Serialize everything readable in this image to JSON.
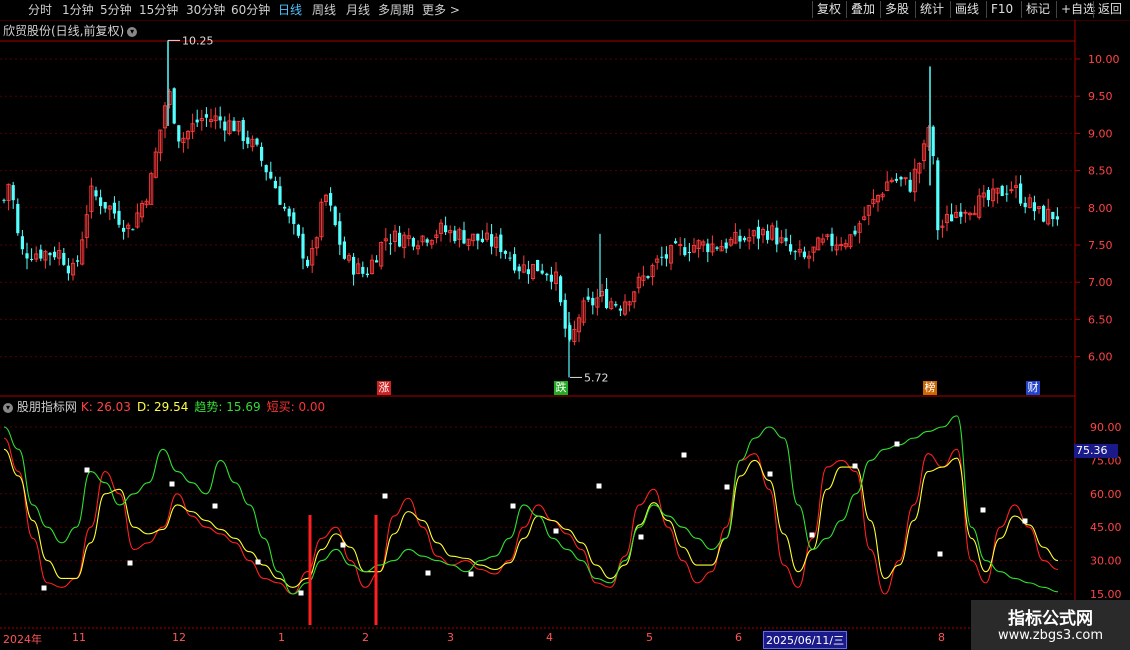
{
  "toolbar": {
    "periods": [
      "分时",
      "1分钟",
      "5分钟",
      "15分钟",
      "30分钟",
      "60分钟",
      "日线",
      "周线",
      "月线",
      "多周期",
      "更多 >"
    ],
    "active_period": "日线",
    "right_buttons": [
      "复权",
      "叠加",
      "多股",
      "统计",
      "画线",
      "F10",
      "标记",
      "+自选",
      "返回"
    ]
  },
  "stock": {
    "title": "欣贸股份(日线,前复权)"
  },
  "price_axis": [
    "10.00",
    "9.50",
    "9.00",
    "8.50",
    "8.00",
    "7.50",
    "7.00",
    "6.50",
    "6.00"
  ],
  "price_markers": {
    "high": "10.25",
    "low": "5.72"
  },
  "flags": [
    {
      "label": "涨",
      "color": "#cc2222"
    },
    {
      "label": "跌",
      "color": "#22aa22"
    },
    {
      "label": "榜",
      "color": "#cc6600"
    },
    {
      "label": "财",
      "color": "#2244cc"
    }
  ],
  "indicator": {
    "name": "股朋指标网",
    "k": "K: 26.03",
    "d": "D: 29.54",
    "trend": "趋势: 15.69",
    "buy": "短买: 0.00",
    "axis": [
      "90.00",
      "75.00",
      "60.00",
      "45.00",
      "30.00",
      "15.00"
    ],
    "current_value": "75.36"
  },
  "x_axis": [
    "2024年",
    "11",
    "12",
    "1",
    "2",
    "3",
    "4",
    "5",
    "6",
    "2025/06/11/三",
    "8"
  ],
  "watermark": {
    "title": "指标公式网",
    "url": "www.zbgs3.com"
  },
  "colors": {
    "up": "#ff3b3b",
    "down": "#54ffff",
    "k_line": "#ff2020",
    "d_line": "#ffff30",
    "trend_line": "#30e030"
  },
  "chart_data": {
    "type": "candlestick+line",
    "price_range": [
      5.72,
      10.25
    ],
    "indicator_range": [
      0,
      100
    ],
    "series": [
      {
        "name": "K",
        "values": [
          85,
          70,
          40,
          20,
          18,
          22,
          45,
          70,
          60,
          35,
          38,
          45,
          60,
          50,
          45,
          42,
          38,
          30,
          22,
          20,
          15,
          25,
          40,
          45,
          30,
          18,
          25,
          50,
          58,
          45,
          32,
          28,
          30,
          26,
          24,
          30,
          45,
          55,
          48,
          42,
          35,
          20,
          18,
          32,
          55,
          62,
          45,
          30,
          20,
          25,
          45,
          75,
          78,
          62,
          28,
          18,
          40,
          72,
          75,
          70,
          35,
          15,
          30,
          55,
          78,
          72,
          80,
          30,
          20,
          45,
          55,
          45,
          30,
          26
        ]
      },
      {
        "name": "D",
        "values": [
          80,
          68,
          48,
          30,
          22,
          22,
          38,
          60,
          62,
          45,
          42,
          44,
          55,
          52,
          48,
          44,
          40,
          34,
          28,
          22,
          18,
          22,
          35,
          42,
          36,
          25,
          25,
          42,
          52,
          48,
          38,
          32,
          31,
          28,
          26,
          29,
          40,
          50,
          48,
          44,
          38,
          28,
          22,
          28,
          46,
          56,
          48,
          36,
          28,
          28,
          40,
          68,
          75,
          66,
          42,
          25,
          35,
          62,
          72,
          72,
          48,
          22,
          28,
          48,
          70,
          72,
          76,
          40,
          25,
          40,
          50,
          46,
          36,
          30
        ]
      },
      {
        "name": "趋势",
        "values": [
          90,
          80,
          55,
          45,
          38,
          45,
          70,
          65,
          55,
          60,
          65,
          80,
          70,
          65,
          60,
          75,
          65,
          55,
          40,
          25,
          15,
          20,
          30,
          35,
          28,
          25,
          28,
          30,
          35,
          32,
          30,
          28,
          25,
          30,
          32,
          40,
          55,
          50,
          40,
          35,
          30,
          22,
          20,
          30,
          45,
          55,
          50,
          45,
          40,
          35,
          40,
          75,
          85,
          90,
          85,
          55,
          35,
          40,
          48,
          60,
          75,
          80,
          82,
          85,
          88,
          90,
          95,
          45,
          30,
          25,
          22,
          20,
          18,
          16
        ]
      }
    ]
  }
}
